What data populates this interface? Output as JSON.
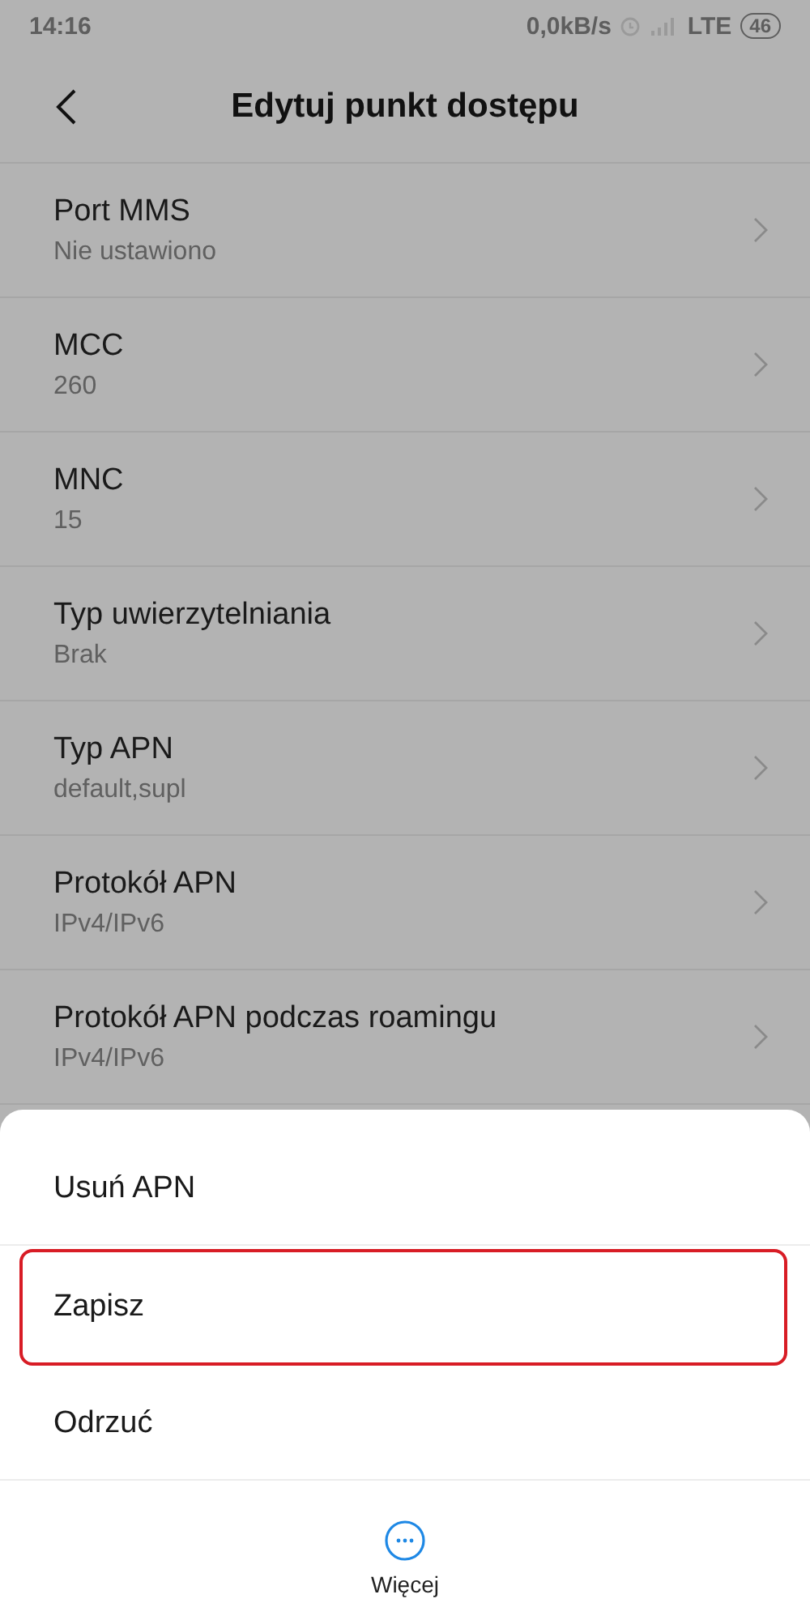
{
  "status_bar": {
    "time": "14:16",
    "speed": "0,0kB/s",
    "network": "LTE",
    "battery": "46"
  },
  "header": {
    "title": "Edytuj punkt dostępu"
  },
  "settings": [
    {
      "title": "Port MMS",
      "value": "Nie ustawiono"
    },
    {
      "title": "MCC",
      "value": "260"
    },
    {
      "title": "MNC",
      "value": "15"
    },
    {
      "title": "Typ uwierzytelniania",
      "value": "Brak"
    },
    {
      "title": "Typ APN",
      "value": "default,supl"
    },
    {
      "title": "Protokół APN",
      "value": "IPv4/IPv6"
    },
    {
      "title": "Protokół APN podczas roamingu",
      "value": "IPv4/IPv6"
    }
  ],
  "action_sheet": {
    "actions": [
      {
        "label": "Usuń APN",
        "highlighted": false
      },
      {
        "label": "Zapisz",
        "highlighted": true
      },
      {
        "label": "Odrzuć",
        "highlighted": false
      }
    ],
    "more": {
      "label": "Więcej"
    }
  }
}
